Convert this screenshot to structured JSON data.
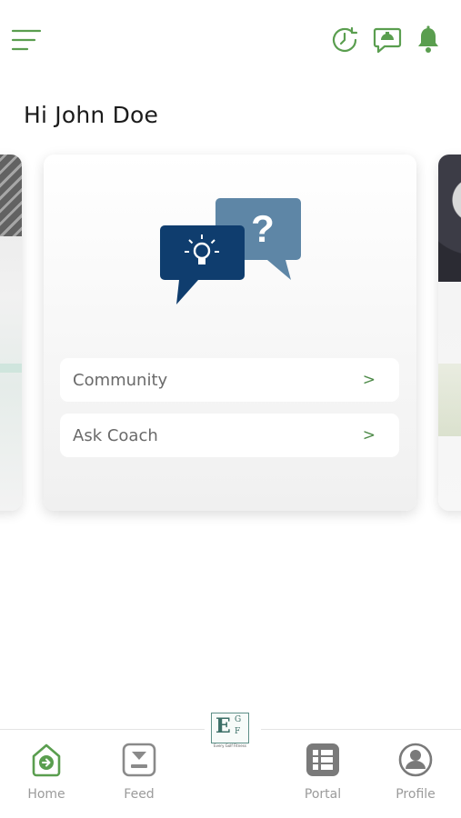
{
  "greeting": "Hi John Doe",
  "colors": {
    "accent": "#5a9e4f",
    "navy": "#0f3d6e",
    "slate": "#5e86a6",
    "nav_inactive": "#9b9b9b"
  },
  "top_icons": [
    "menu-icon",
    "clock-icon",
    "chat-icon",
    "bell-icon"
  ],
  "card": {
    "items": [
      {
        "label": "Community",
        "chevron": ">"
      },
      {
        "label": "Ask Coach",
        "chevron": ">"
      }
    ]
  },
  "logo": {
    "letter": "E",
    "letter_g": "G",
    "letter_f": "F",
    "tagline": "Every Golf Fitness"
  },
  "nav": [
    {
      "label": "Home",
      "icon": "home-icon",
      "active": true
    },
    {
      "label": "Feed",
      "icon": "feed-icon",
      "active": false
    },
    {
      "label": "Portal",
      "icon": "portal-icon",
      "active": false
    },
    {
      "label": "Profile",
      "icon": "profile-icon",
      "active": false
    }
  ]
}
